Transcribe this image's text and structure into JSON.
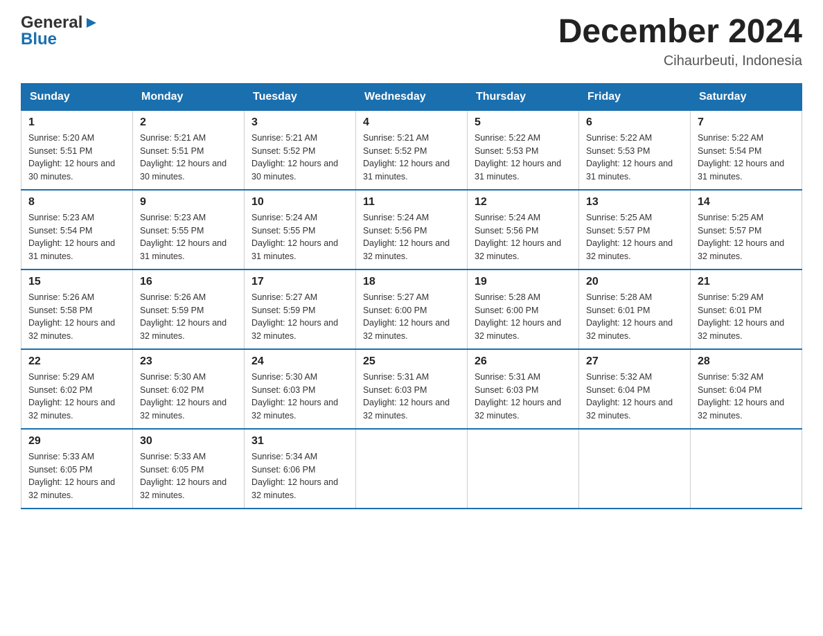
{
  "header": {
    "logo_general": "General",
    "logo_blue": "Blue",
    "month_title": "December 2024",
    "location": "Cihaurbeuti, Indonesia"
  },
  "days_of_week": [
    "Sunday",
    "Monday",
    "Tuesday",
    "Wednesday",
    "Thursday",
    "Friday",
    "Saturday"
  ],
  "weeks": [
    [
      {
        "day": 1,
        "sunrise": "5:20 AM",
        "sunset": "5:51 PM",
        "daylight": "12 hours and 30 minutes."
      },
      {
        "day": 2,
        "sunrise": "5:21 AM",
        "sunset": "5:51 PM",
        "daylight": "12 hours and 30 minutes."
      },
      {
        "day": 3,
        "sunrise": "5:21 AM",
        "sunset": "5:52 PM",
        "daylight": "12 hours and 30 minutes."
      },
      {
        "day": 4,
        "sunrise": "5:21 AM",
        "sunset": "5:52 PM",
        "daylight": "12 hours and 31 minutes."
      },
      {
        "day": 5,
        "sunrise": "5:22 AM",
        "sunset": "5:53 PM",
        "daylight": "12 hours and 31 minutes."
      },
      {
        "day": 6,
        "sunrise": "5:22 AM",
        "sunset": "5:53 PM",
        "daylight": "12 hours and 31 minutes."
      },
      {
        "day": 7,
        "sunrise": "5:22 AM",
        "sunset": "5:54 PM",
        "daylight": "12 hours and 31 minutes."
      }
    ],
    [
      {
        "day": 8,
        "sunrise": "5:23 AM",
        "sunset": "5:54 PM",
        "daylight": "12 hours and 31 minutes."
      },
      {
        "day": 9,
        "sunrise": "5:23 AM",
        "sunset": "5:55 PM",
        "daylight": "12 hours and 31 minutes."
      },
      {
        "day": 10,
        "sunrise": "5:24 AM",
        "sunset": "5:55 PM",
        "daylight": "12 hours and 31 minutes."
      },
      {
        "day": 11,
        "sunrise": "5:24 AM",
        "sunset": "5:56 PM",
        "daylight": "12 hours and 32 minutes."
      },
      {
        "day": 12,
        "sunrise": "5:24 AM",
        "sunset": "5:56 PM",
        "daylight": "12 hours and 32 minutes."
      },
      {
        "day": 13,
        "sunrise": "5:25 AM",
        "sunset": "5:57 PM",
        "daylight": "12 hours and 32 minutes."
      },
      {
        "day": 14,
        "sunrise": "5:25 AM",
        "sunset": "5:57 PM",
        "daylight": "12 hours and 32 minutes."
      }
    ],
    [
      {
        "day": 15,
        "sunrise": "5:26 AM",
        "sunset": "5:58 PM",
        "daylight": "12 hours and 32 minutes."
      },
      {
        "day": 16,
        "sunrise": "5:26 AM",
        "sunset": "5:59 PM",
        "daylight": "12 hours and 32 minutes."
      },
      {
        "day": 17,
        "sunrise": "5:27 AM",
        "sunset": "5:59 PM",
        "daylight": "12 hours and 32 minutes."
      },
      {
        "day": 18,
        "sunrise": "5:27 AM",
        "sunset": "6:00 PM",
        "daylight": "12 hours and 32 minutes."
      },
      {
        "day": 19,
        "sunrise": "5:28 AM",
        "sunset": "6:00 PM",
        "daylight": "12 hours and 32 minutes."
      },
      {
        "day": 20,
        "sunrise": "5:28 AM",
        "sunset": "6:01 PM",
        "daylight": "12 hours and 32 minutes."
      },
      {
        "day": 21,
        "sunrise": "5:29 AM",
        "sunset": "6:01 PM",
        "daylight": "12 hours and 32 minutes."
      }
    ],
    [
      {
        "day": 22,
        "sunrise": "5:29 AM",
        "sunset": "6:02 PM",
        "daylight": "12 hours and 32 minutes."
      },
      {
        "day": 23,
        "sunrise": "5:30 AM",
        "sunset": "6:02 PM",
        "daylight": "12 hours and 32 minutes."
      },
      {
        "day": 24,
        "sunrise": "5:30 AM",
        "sunset": "6:03 PM",
        "daylight": "12 hours and 32 minutes."
      },
      {
        "day": 25,
        "sunrise": "5:31 AM",
        "sunset": "6:03 PM",
        "daylight": "12 hours and 32 minutes."
      },
      {
        "day": 26,
        "sunrise": "5:31 AM",
        "sunset": "6:03 PM",
        "daylight": "12 hours and 32 minutes."
      },
      {
        "day": 27,
        "sunrise": "5:32 AM",
        "sunset": "6:04 PM",
        "daylight": "12 hours and 32 minutes."
      },
      {
        "day": 28,
        "sunrise": "5:32 AM",
        "sunset": "6:04 PM",
        "daylight": "12 hours and 32 minutes."
      }
    ],
    [
      {
        "day": 29,
        "sunrise": "5:33 AM",
        "sunset": "6:05 PM",
        "daylight": "12 hours and 32 minutes."
      },
      {
        "day": 30,
        "sunrise": "5:33 AM",
        "sunset": "6:05 PM",
        "daylight": "12 hours and 32 minutes."
      },
      {
        "day": 31,
        "sunrise": "5:34 AM",
        "sunset": "6:06 PM",
        "daylight": "12 hours and 32 minutes."
      },
      null,
      null,
      null,
      null
    ]
  ],
  "labels": {
    "sunrise": "Sunrise:",
    "sunset": "Sunset:",
    "daylight": "Daylight:"
  }
}
